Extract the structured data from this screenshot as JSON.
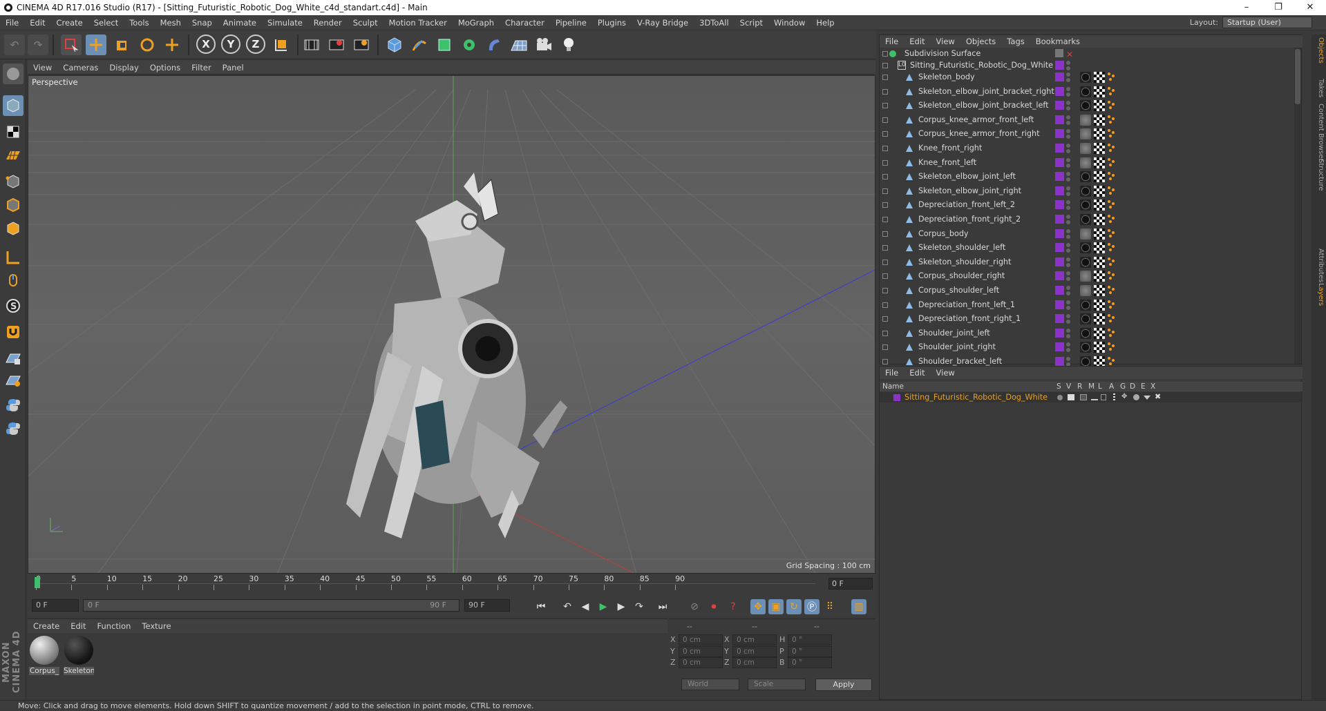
{
  "window": {
    "title": "CINEMA 4D R17.016 Studio (R17) - [Sitting_Futuristic_Robotic_Dog_White_c4d_standart.c4d] - Main",
    "controls": [
      "–",
      "❐",
      "✕"
    ]
  },
  "menubar": {
    "items": [
      "File",
      "Edit",
      "Create",
      "Select",
      "Tools",
      "Mesh",
      "Snap",
      "Animate",
      "Simulate",
      "Render",
      "Sculpt",
      "Motion Tracker",
      "MoGraph",
      "Character",
      "Pipeline",
      "Plugins",
      "V-Ray Bridge",
      "3DToAll",
      "Script",
      "Window",
      "Help"
    ],
    "layout_label": "Layout:",
    "layout_value": "Startup (User)"
  },
  "toolbar": {
    "axis_x": "X",
    "axis_y": "Y",
    "axis_z": "Z"
  },
  "viewport": {
    "menu": [
      "View",
      "Cameras",
      "Display",
      "Options",
      "Filter",
      "Panel"
    ],
    "label": "Perspective",
    "grid_spacing": "Grid Spacing : 100 cm"
  },
  "timeline": {
    "ticks": [
      "0",
      "5",
      "10",
      "15",
      "20",
      "25",
      "30",
      "35",
      "40",
      "45",
      "50",
      "55",
      "60",
      "65",
      "70",
      "75",
      "80",
      "85",
      "90"
    ],
    "current_frame": "0 F",
    "start_field": "0 F",
    "range_start": "0 F",
    "range_end": "90 F",
    "end_field": "90 F"
  },
  "materials": {
    "menu": [
      "Create",
      "Edit",
      "Function",
      "Texture"
    ],
    "items": [
      {
        "name": "Corpus_"
      },
      {
        "name": "Skeleton"
      }
    ]
  },
  "coordinates": {
    "header": [
      "--",
      "--",
      "--"
    ],
    "rows": [
      {
        "a": "X",
        "av": "0 cm",
        "b": "X",
        "bv": "0 cm",
        "c": "H",
        "cv": "0 °"
      },
      {
        "a": "Y",
        "av": "0 cm",
        "b": "Y",
        "bv": "0 cm",
        "c": "P",
        "cv": "0 °"
      },
      {
        "a": "Z",
        "av": "0 cm",
        "b": "Z",
        "bv": "0 cm",
        "c": "B",
        "cv": "0 °"
      }
    ],
    "mode1": "World",
    "mode2": "Scale",
    "apply": "Apply"
  },
  "objects": {
    "menu": [
      "File",
      "Edit",
      "View",
      "Objects",
      "Tags",
      "Bookmarks"
    ],
    "root": "Subdivision Surface",
    "group": "Sitting_Futuristic_Robotic_Dog_White",
    "items": [
      {
        "name": "Skeleton_body",
        "mat": "dark"
      },
      {
        "name": "Skeleton_elbow_joint_bracket_right",
        "mat": "dark"
      },
      {
        "name": "Skeleton_elbow_joint_bracket_left",
        "mat": "dark"
      },
      {
        "name": "Corpus_knee_armor_front_left",
        "mat": "light"
      },
      {
        "name": "Corpus_knee_armor_front_right",
        "mat": "light"
      },
      {
        "name": "Knee_front_right",
        "mat": "light"
      },
      {
        "name": "Knee_front_left",
        "mat": "light"
      },
      {
        "name": "Skeleton_elbow_joint_left",
        "mat": "dark"
      },
      {
        "name": "Skeleton_elbow_joint_right",
        "mat": "dark"
      },
      {
        "name": "Depreciation_front_left_2",
        "mat": "dark"
      },
      {
        "name": "Depreciation_front_right_2",
        "mat": "dark"
      },
      {
        "name": "Corpus_body",
        "mat": "light"
      },
      {
        "name": "Skeleton_shoulder_left",
        "mat": "dark"
      },
      {
        "name": "Skeleton_shoulder_right",
        "mat": "dark"
      },
      {
        "name": "Corpus_shoulder_right",
        "mat": "light"
      },
      {
        "name": "Corpus_shoulder_left",
        "mat": "light"
      },
      {
        "name": "Depreciation_front_left_1",
        "mat": "dark"
      },
      {
        "name": "Depreciation_front_right_1",
        "mat": "dark"
      },
      {
        "name": "Shoulder_joint_left",
        "mat": "dark"
      },
      {
        "name": "Shoulder_joint_right",
        "mat": "dark"
      },
      {
        "name": "Shoulder_bracket_left",
        "mat": "dark"
      }
    ]
  },
  "layers": {
    "menu": [
      "File",
      "Edit",
      "View"
    ],
    "columns": [
      "Name",
      "S",
      "V",
      "R",
      "M",
      "L",
      "A",
      "G",
      "D",
      "E",
      "X"
    ],
    "row_name": "Sitting_Futuristic_Robotic_Dog_White"
  },
  "sidetabs": [
    "Objects",
    "Takes",
    "Content Browser",
    "Structure",
    "Attributes",
    "Layers"
  ],
  "status": "Move: Click and drag to move elements. Hold down SHIFT to quantize movement / add to the selection in point mode, CTRL to remove.",
  "logo": "MAXON CINEMA 4D",
  "colors": {
    "accent": "#8b32c8",
    "orange": "#f39b1a",
    "layer_text": "#e8a020"
  }
}
